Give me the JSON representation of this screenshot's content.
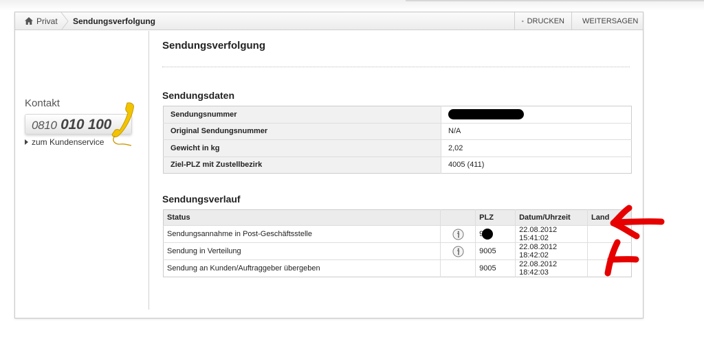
{
  "breadcrumb": {
    "home_label": "Privat",
    "current_label": "Sendungsverfolgung"
  },
  "toolbar": {
    "print_label": "DRUCKEN",
    "share_label": "WEITERSAGEN"
  },
  "sidebar": {
    "kontakt_title": "Kontakt",
    "phone_prefix": "0810",
    "phone_main": "010 100",
    "service_link": "zum Kundenservice"
  },
  "main": {
    "page_title": "Sendungsverfolgung",
    "details_title": "Sendungsdaten",
    "details": [
      {
        "label": "Sendungsnummer",
        "value": ""
      },
      {
        "label": "Original Sendungsnummer",
        "value": "N/A"
      },
      {
        "label": "Gewicht in kg",
        "value": "2,02"
      },
      {
        "label": "Ziel-PLZ mit Zustellbezirk",
        "value": "4005 (411)"
      }
    ],
    "history_title": "Sendungsverlauf",
    "history_headers": {
      "status": "Status",
      "info": "",
      "plz": "PLZ",
      "date": "Datum/Uhrzeit",
      "land": "Land"
    },
    "history": [
      {
        "status": "Sendungsannahme in Post-Geschäftsstelle",
        "plz": "9",
        "date": "22.08.2012 15:41:02",
        "land": ""
      },
      {
        "status": "Sendung in Verteilung",
        "plz": "9005",
        "date": "22.08.2012 18:42:02",
        "land": ""
      },
      {
        "status": "Sendung an Kunden/Auftraggeber übergeben",
        "plz": "9005",
        "date": "22.08.2012 18:42:03",
        "land": ""
      }
    ]
  },
  "icons": {
    "home": "home-icon",
    "print": "printer-icon",
    "share": "share-plus-icon",
    "phone": "phone-handset-icon",
    "info": "info-icon"
  },
  "colors": {
    "handset": "#f2c400",
    "annotation": "#e60000"
  }
}
